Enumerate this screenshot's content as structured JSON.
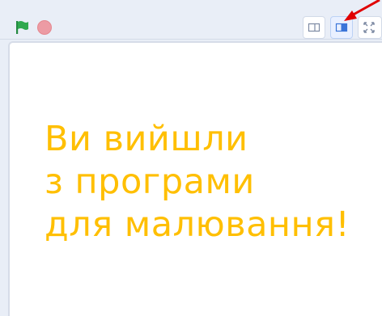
{
  "toolbar": {
    "controls": [
      {
        "name": "green-flag",
        "color": "#2fa84f"
      },
      {
        "name": "stop",
        "color": "#ec9ba4"
      }
    ],
    "stage_size_buttons": [
      {
        "name": "small-stage",
        "active": false
      },
      {
        "name": "large-stage",
        "active": true
      },
      {
        "name": "full-screen",
        "active": false
      }
    ]
  },
  "annotation": {
    "type": "arrow",
    "color": "#e00000"
  },
  "stage": {
    "message_lines": [
      "Ви вийшли",
      "з програми",
      "для малювання!"
    ],
    "text_color": "#ffbf00"
  }
}
